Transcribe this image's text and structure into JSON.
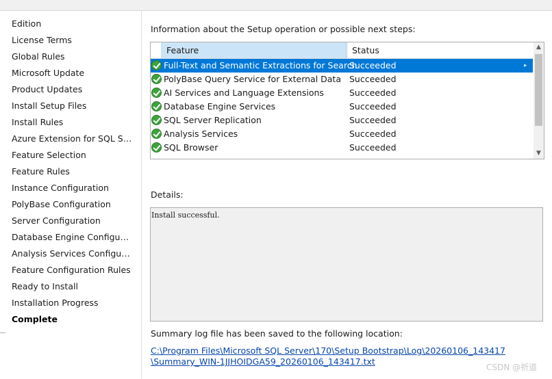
{
  "nav": {
    "items": [
      {
        "label": "Edition"
      },
      {
        "label": "License Terms"
      },
      {
        "label": "Global Rules"
      },
      {
        "label": "Microsoft Update"
      },
      {
        "label": "Product Updates"
      },
      {
        "label": "Install Setup Files"
      },
      {
        "label": "Install Rules"
      },
      {
        "label": "Azure Extension for SQL Ser..."
      },
      {
        "label": "Feature Selection"
      },
      {
        "label": "Feature Rules"
      },
      {
        "label": "Instance Configuration"
      },
      {
        "label": "PolyBase Configuration"
      },
      {
        "label": "Server Configuration"
      },
      {
        "label": "Database Engine Configurat..."
      },
      {
        "label": "Analysis Services Configurati..."
      },
      {
        "label": "Feature Configuration Rules"
      },
      {
        "label": "Ready to Install"
      },
      {
        "label": "Installation Progress"
      },
      {
        "label": "Complete"
      }
    ],
    "current": "Complete"
  },
  "main": {
    "info_label": "Information about the Setup operation or possible next steps:",
    "grid": {
      "headers": {
        "feature": "Feature",
        "status": "Status"
      },
      "rows": [
        {
          "feature": "Full-Text and Semantic Extractions for Search",
          "status": "Succeeded",
          "icon": "success-check-icon"
        },
        {
          "feature": "PolyBase Query Service for External Data",
          "status": "Succeeded",
          "icon": "success-check-icon"
        },
        {
          "feature": "AI Services and Language Extensions",
          "status": "Succeeded",
          "icon": "success-check-icon"
        },
        {
          "feature": "Database Engine Services",
          "status": "Succeeded",
          "icon": "success-check-icon"
        },
        {
          "feature": "SQL Server Replication",
          "status": "Succeeded",
          "icon": "success-check-icon"
        },
        {
          "feature": "Analysis Services",
          "status": "Succeeded",
          "icon": "success-check-icon"
        },
        {
          "feature": "SQL Browser",
          "status": "Succeeded",
          "icon": "success-check-icon"
        }
      ],
      "selected_index": 0
    },
    "details_label": "Details:",
    "details_text": "Install successful.",
    "summary_label": "Summary log file has been saved to the following location:",
    "log_link_line1": "C:\\Program Files\\Microsoft SQL Server\\170\\Setup Bootstrap\\Log\\20260106_143417",
    "log_link_line2": "\\Summary_WIN-1JJHOIDGA59_20260106_143417.txt"
  },
  "watermark": "CSDN @祈道",
  "colors": {
    "selection": "#0078d7",
    "header_highlight": "#cce4f7",
    "link": "#0645ad",
    "success": "#3da33d"
  }
}
